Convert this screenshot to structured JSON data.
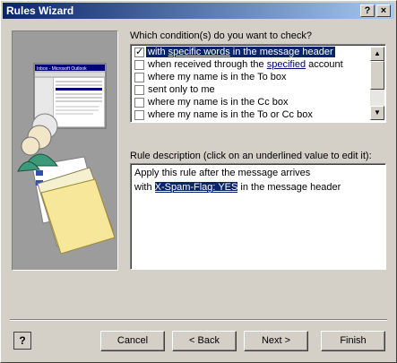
{
  "window": {
    "title": "Rules Wizard",
    "help_glyph": "?",
    "close_glyph": "×"
  },
  "conditions": {
    "heading": "Which condition(s) do you want to check?",
    "items": [
      {
        "before": "with ",
        "link": "specific words",
        "after": " in the message header",
        "checked": true,
        "selected": true
      },
      {
        "before": "when received through the ",
        "link": "specified",
        "after": " account",
        "checked": false,
        "selected": false
      },
      {
        "before": "where my name is in the To box",
        "link": "",
        "after": "",
        "checked": false,
        "selected": false
      },
      {
        "before": "sent only to me",
        "link": "",
        "after": "",
        "checked": false,
        "selected": false
      },
      {
        "before": "where my name is in the Cc box",
        "link": "",
        "after": "",
        "checked": false,
        "selected": false
      },
      {
        "before": "where my name is in the To or Cc box",
        "link": "",
        "after": "",
        "checked": false,
        "selected": false
      }
    ]
  },
  "description": {
    "heading": "Rule description (click on an underlined value to edit it):",
    "line1": "Apply this rule after the message arrives",
    "line2_before": "with ",
    "line2_value": "X-Spam-Flag: YES",
    "line2_after": " in the message header"
  },
  "buttons": {
    "cancel": "Cancel",
    "back": "< Back",
    "next": "Next >",
    "finish": "Finish"
  },
  "illustration": {
    "window_title": "Inbox - Microsoft Outlook"
  },
  "colors": {
    "selection": "#0a246a",
    "face": "#d4d0c8",
    "title_start": "#0a246a",
    "title_end": "#a6caf0"
  }
}
